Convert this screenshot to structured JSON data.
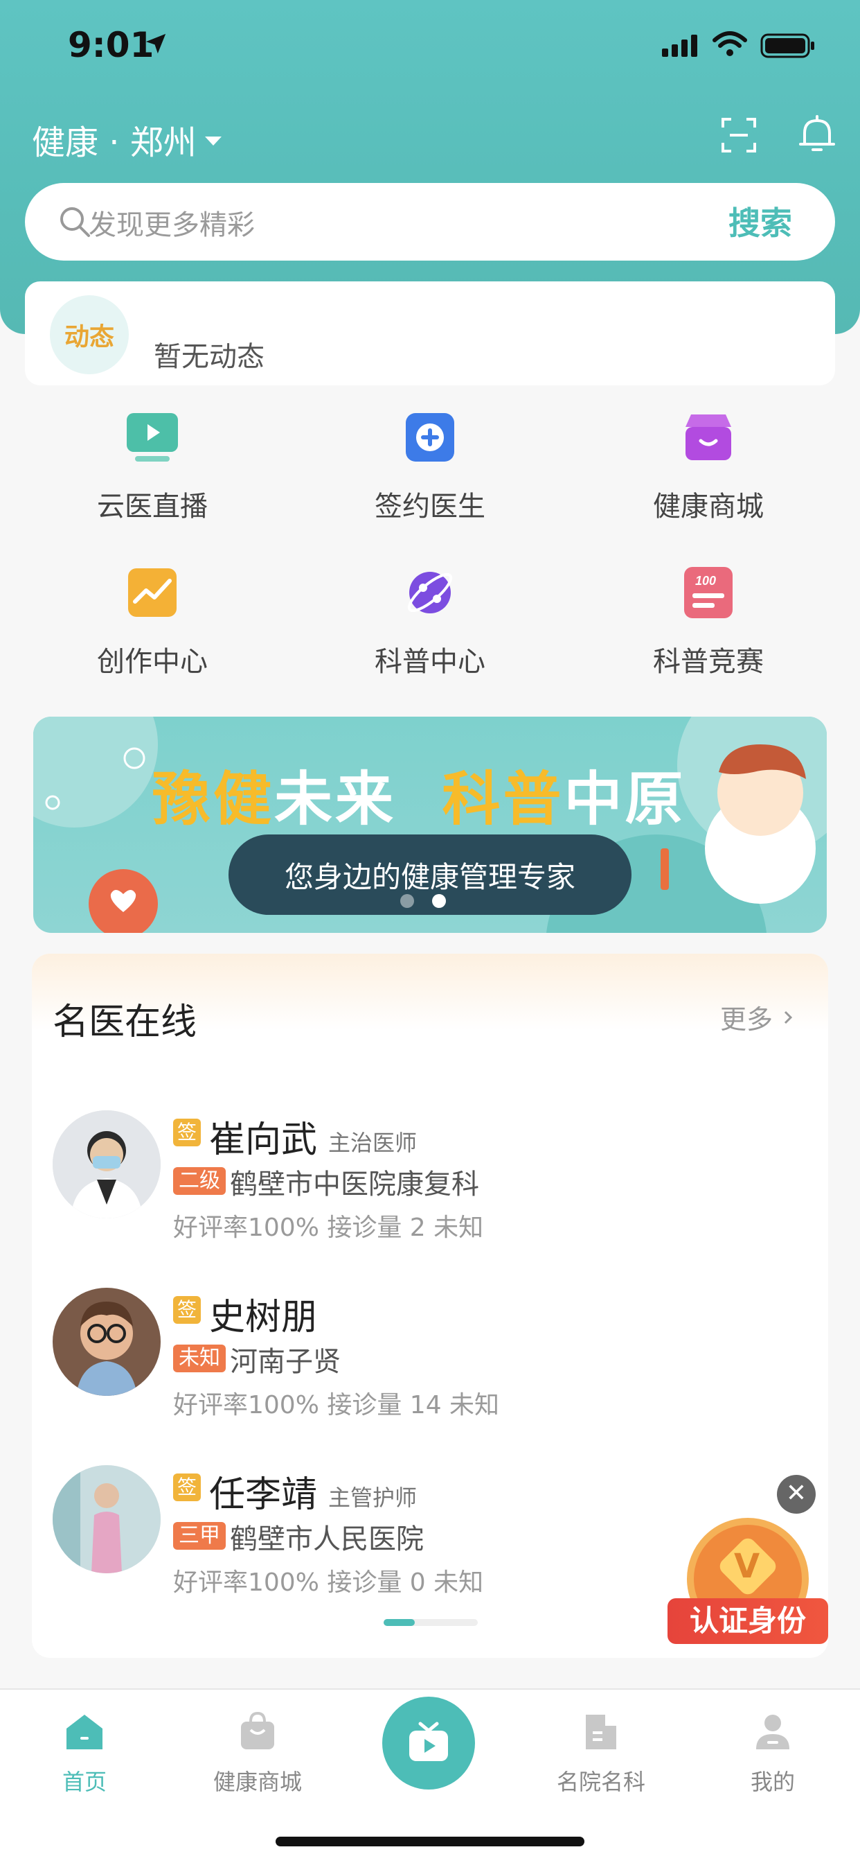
{
  "status": {
    "time": "9:01"
  },
  "header": {
    "city_label": "健康 · 郑州"
  },
  "search": {
    "placeholder": "发现更多精彩",
    "button": "搜索"
  },
  "dynamics": {
    "badge": "动态",
    "text": "暂无动态"
  },
  "quick_menu": [
    {
      "label": "云医直播",
      "icon": "live-video-icon",
      "color": "#4dbfa8"
    },
    {
      "label": "签约医生",
      "icon": "medical-plus-icon",
      "color": "#3d7be8"
    },
    {
      "label": "健康商城",
      "icon": "shop-icon",
      "color": "#b24be0"
    },
    {
      "label": "创作中心",
      "icon": "chart-up-icon",
      "color": "#f4b136"
    },
    {
      "label": "科普中心",
      "icon": "planet-icon",
      "color": "#7c4de0"
    },
    {
      "label": "科普竞赛",
      "icon": "score-100-icon",
      "color": "#ea6a7c"
    }
  ],
  "banner": {
    "title_part1": "豫健",
    "title_part2": "未来",
    "title_part3": "科普",
    "title_part4": "中原",
    "subtitle": "您身边的健康管理专家",
    "active_dot": 2,
    "dot_count": 2
  },
  "doctors_section": {
    "title": "名医在线",
    "more": "更多",
    "doctors": [
      {
        "sign": "签",
        "name": "崔向武",
        "title": "主治医师",
        "level": "二级",
        "hospital": "鹤壁市中医院康复科",
        "stats": "好评率100% 接诊量 2 未知"
      },
      {
        "sign": "签",
        "name": "史树朋",
        "title": "",
        "level": "未知",
        "hospital": "河南子贤",
        "stats": "好评率100% 接诊量 14 未知"
      },
      {
        "sign": "签",
        "name": "任李靖",
        "title": "主管护师",
        "level": "三甲",
        "hospital": "鹤壁市人民医院",
        "stats": "好评率100% 接诊量 0 未知"
      }
    ],
    "scroll_progress": 0.33
  },
  "floating": {
    "close": "✕",
    "label": "认证身份"
  },
  "tabbar": [
    {
      "label": "首页",
      "active": true
    },
    {
      "label": "健康商城",
      "active": false
    },
    {
      "label": "",
      "active": false
    },
    {
      "label": "名院名科",
      "active": false
    },
    {
      "label": "我的",
      "active": false
    }
  ],
  "colors": {
    "primary": "#4dbdb7",
    "header": "#5fc4c2",
    "accent_orange": "#ef7a4a",
    "sign_yellow": "#f1b43a"
  }
}
